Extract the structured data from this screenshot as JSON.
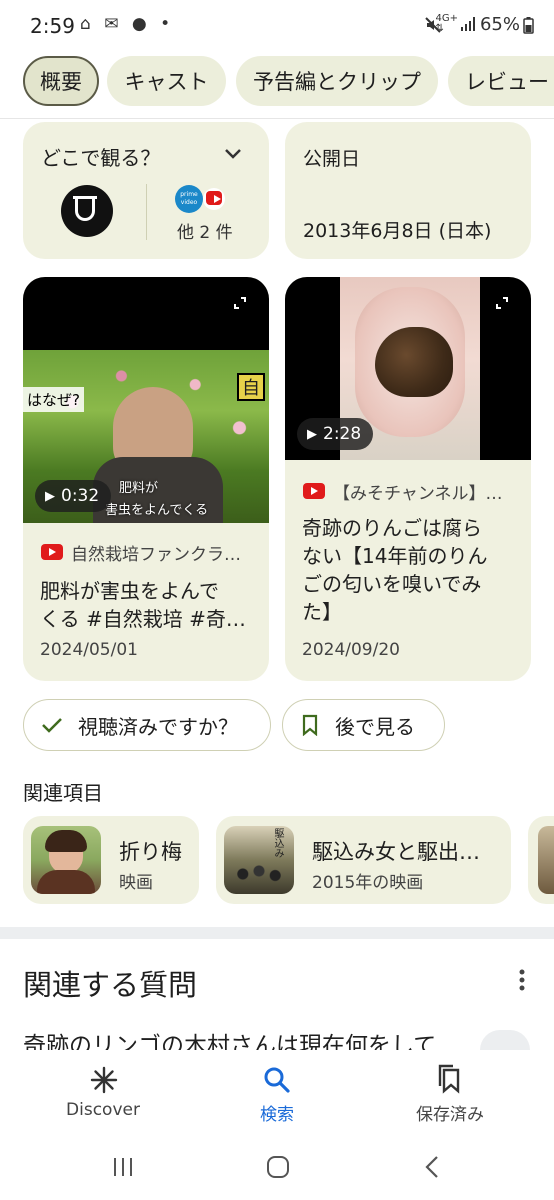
{
  "status_bar": {
    "time": "2:59",
    "left_icons": "⌂ ✉ ● •",
    "battery": "65%"
  },
  "chips": [
    "概要",
    "キャスト",
    "予告編とクリップ",
    "レビュー"
  ],
  "watch": {
    "title": "どこで観る？",
    "others": "他 2 件",
    "prime_label": "prime video"
  },
  "release": {
    "label": "公開日",
    "value": "2013年6月8日 (日本)"
  },
  "videos": [
    {
      "duration": "0:32",
      "channel": "自然栽培ファンクラ…",
      "title_line1": "肥料が害虫をよんで",
      "title_line2": "くる #自然栽培 #奇…",
      "date": "2024/05/01",
      "overlay_left": "はなぜ?",
      "overlay_right": "自",
      "caption_line1": "肥料が",
      "caption_line2": "害虫をよんでくる"
    },
    {
      "duration": "2:28",
      "channel": "【みそチャンネル】…",
      "title_line1": "奇跡のりんごは腐ら",
      "title_line2": "ない【14年前のりん",
      "title_line3": "ごの匂いを嗅いでみ",
      "title_line4": "た】",
      "date": "2024/09/20"
    }
  ],
  "actions": {
    "watched": "視聴済みですか？",
    "later": "後で見る"
  },
  "related": {
    "heading": "関連項目",
    "items": [
      {
        "title": "折り梅",
        "subtitle": "映画"
      },
      {
        "title": "駆込み女と駆出…",
        "subtitle": "2015年の映画",
        "poster_text": "駆込み"
      }
    ]
  },
  "questions": {
    "heading": "関連する質問",
    "first": "奇跡のリンゴの木村さんは現在何をして"
  },
  "bottom_nav": [
    {
      "label": "Discover",
      "icon": "asterisk-icon"
    },
    {
      "label": "検索",
      "icon": "search-icon"
    },
    {
      "label": "保存済み",
      "icon": "bookmarks-icon"
    }
  ],
  "colors": {
    "chip_bg": "#eceedb",
    "card_bg": "#f0f1e0",
    "accent_blue": "#1a6ad8",
    "check_green": "#3f6b1e"
  }
}
